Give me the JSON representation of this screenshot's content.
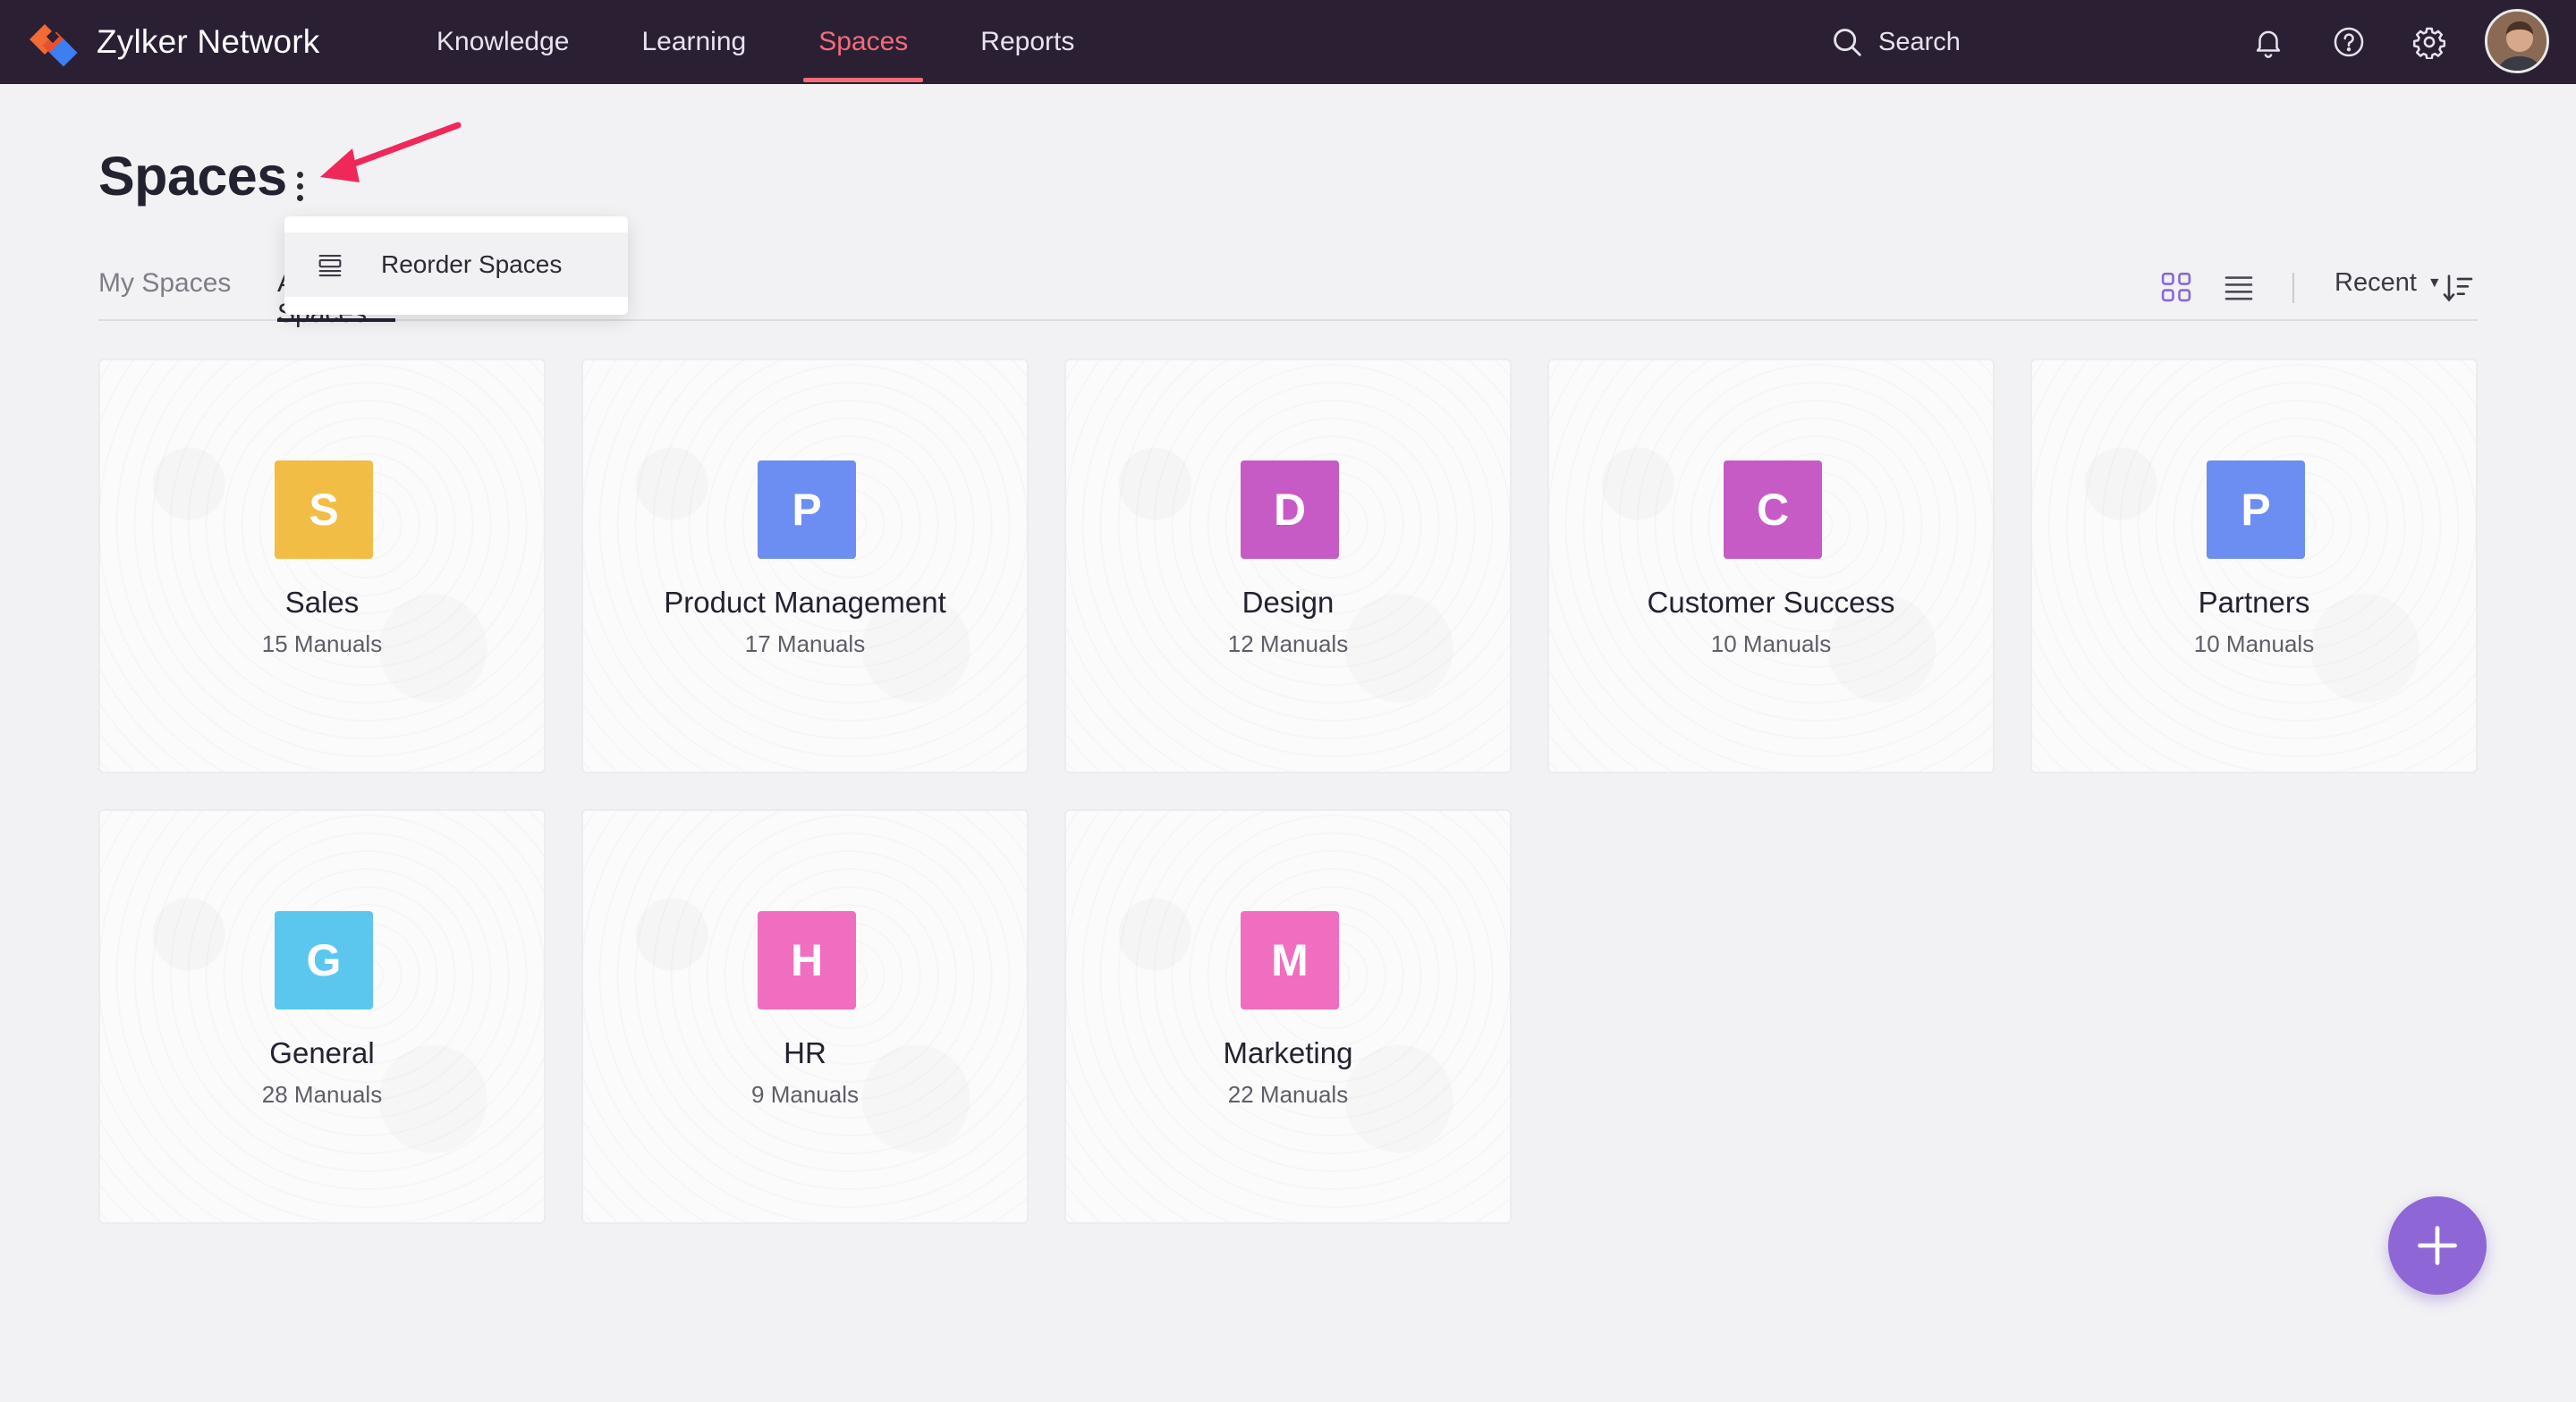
{
  "app": {
    "brand_name": "Zylker Network",
    "brand_icon": "zylker-logo",
    "nav": [
      {
        "label": "Knowledge",
        "active": false
      },
      {
        "label": "Learning",
        "active": false
      },
      {
        "label": "Spaces",
        "active": true
      },
      {
        "label": "Reports",
        "active": false
      }
    ],
    "search_label": "Search",
    "icons": [
      "bell-icon",
      "help-icon",
      "gear-icon",
      "avatar"
    ]
  },
  "page": {
    "title": "Spaces",
    "tabs": [
      {
        "label": "My Spaces",
        "active": false
      },
      {
        "label": "All Spaces",
        "active": true
      }
    ],
    "menu": {
      "items": [
        {
          "label": "Reorder Spaces",
          "icon": "reorder-icon"
        }
      ]
    },
    "sort_label": "Recent",
    "annotation_arrow_color": "#f0285a"
  },
  "colors": {
    "topbar": "#2a1f33",
    "accent": "#f46b7c",
    "fab": "#8e66d6"
  },
  "spaces": [
    {
      "letter": "S",
      "name": "Sales",
      "count": "15 Manuals",
      "color": "#f2bd45"
    },
    {
      "letter": "P",
      "name": "Product Management",
      "count": "17 Manuals",
      "color": "#6c8df2"
    },
    {
      "letter": "D",
      "name": "Design",
      "count": "12 Manuals",
      "color": "#c75bc6"
    },
    {
      "letter": "C",
      "name": "Customer Success",
      "count": "10 Manuals",
      "color": "#c75bc6"
    },
    {
      "letter": "P",
      "name": "Partners",
      "count": "10 Manuals",
      "color": "#6c8df2"
    },
    {
      "letter": "G",
      "name": "General",
      "count": "28 Manuals",
      "color": "#5cc7ee"
    },
    {
      "letter": "H",
      "name": "HR",
      "count": "9 Manuals",
      "color": "#f06ec0"
    },
    {
      "letter": "M",
      "name": "Marketing",
      "count": "22 Manuals",
      "color": "#f06ec0"
    }
  ]
}
